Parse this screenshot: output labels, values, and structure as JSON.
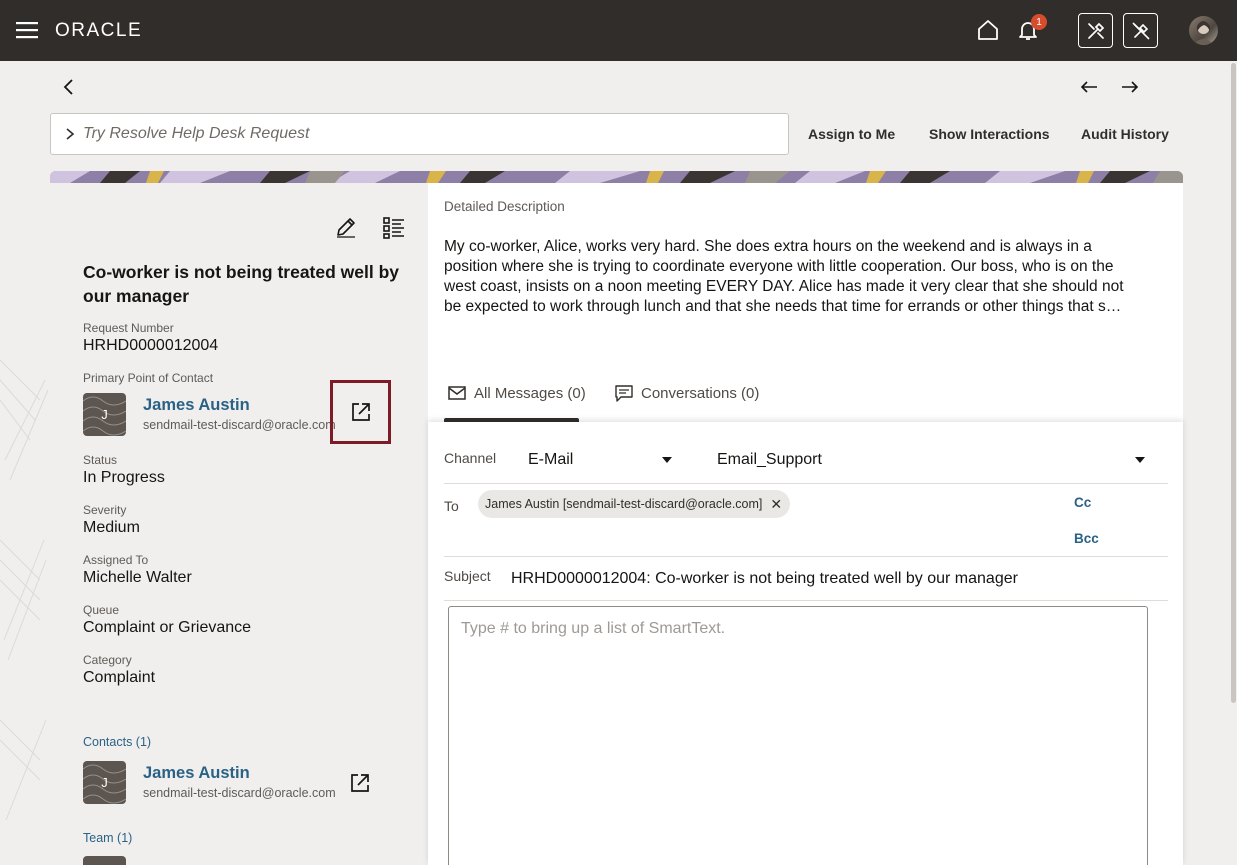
{
  "header": {
    "logo": "ORACLE",
    "notification_count": "1",
    "icons": [
      "hamburger-icon",
      "home-icon",
      "bell-icon",
      "tools-icon",
      "tools-off-icon",
      "user-avatar"
    ]
  },
  "toolbar": {
    "search_placeholder": "Try Resolve Help Desk Request",
    "assign_to_me": "Assign to Me",
    "show_interactions": "Show Interactions",
    "audit_history": "Audit History"
  },
  "request": {
    "title": "Co-worker is not being treated well by our manager",
    "request_number_label": "Request Number",
    "request_number": "HRHD0000012004",
    "primary_contact_label": "Primary Point of Contact",
    "primary_contact": {
      "initial": "J",
      "name": "James Austin",
      "email": "sendmail-test-discard@oracle.com"
    },
    "status_label": "Status",
    "status": "In Progress",
    "severity_label": "Severity",
    "severity": "Medium",
    "assigned_to_label": "Assigned To",
    "assigned_to": "Michelle Walter",
    "queue_label": "Queue",
    "queue": "Complaint or Grievance",
    "category_label": "Category",
    "category": "Complaint",
    "contacts_label": "Contacts (1)",
    "contacts": [
      {
        "initial": "J",
        "name": "James Austin",
        "email": "sendmail-test-discard@oracle.com"
      }
    ],
    "team_label": "Team (1)"
  },
  "description": {
    "label": "Detailed Description",
    "lines": [
      "My co-worker, Alice, works very hard. She does extra hours on the weekend and is always in a",
      "position where she is trying to coordinate everyone with little cooperation. Our boss, who is on the",
      "west coast, insists on a noon meeting EVERY DAY. Alice has made it very clear that she should not",
      "be expected to work through lunch and that she needs that time for errands or other things that s…"
    ]
  },
  "tabs": [
    {
      "label": "All Messages (0)",
      "icon": "envelope-icon",
      "selected": true
    },
    {
      "label": "Conversations (0)",
      "icon": "chat-icon",
      "selected": false
    }
  ],
  "compose": {
    "channel_label": "Channel",
    "channel_value": "E-Mail",
    "from_value": "Email_Support",
    "to_label": "To",
    "to_chip": "James Austin [sendmail-test-discard@oracle.com]",
    "cc": "Cc",
    "bcc": "Bcc",
    "subject_label": "Subject",
    "subject_value": "HRHD0000012004: Co-worker is not being treated well by our manager",
    "body_placeholder": "Type # to bring up a list of SmartText."
  },
  "colors": {
    "topbar": "#312d2a",
    "link": "#2a6286",
    "highlight_border": "#7d1b26",
    "badge": "#d54d2c"
  }
}
